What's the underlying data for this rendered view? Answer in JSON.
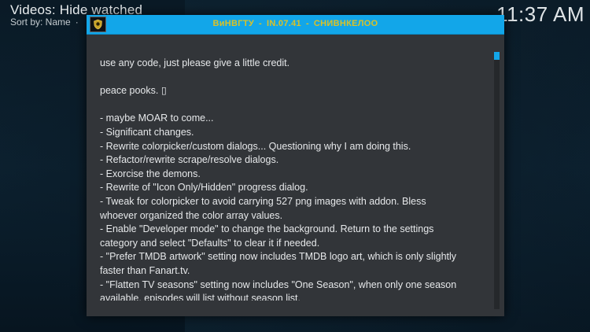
{
  "header": {
    "title": "Videos: Hide watched",
    "sort_label": "Sort by: Name",
    "sort_separator": "·",
    "clock": "11:37 AM"
  },
  "dialog": {
    "icon": "addon-emblem-icon",
    "title_parts": [
      "ВиНВГТУ",
      "​IN.07.41",
      "СНИВНКЕЛОО"
    ],
    "title_separator": "-",
    "accent_color": "#12a6e9",
    "title_color": "#d9c128",
    "scroll_position": 0.0,
    "lines": [
      "use any code, just please give a little credit.",
      "",
      "peace pooks. ▯",
      "",
      "- maybe MOAR to come...",
      "- Significant changes.",
      "- Rewrite colorpicker/custom dialogs...  Questioning why I am doing this.",
      "- Refactor/rewrite scrape/resolve dialogs.",
      "- Exorcise the demons.",
      "- Rewrite of \"Icon Only/Hidden\" progress dialog.",
      "- Tweak for colorpicker to avoid carrying 527 png images with addon.  Bless",
      "whoever organized the color array values.",
      "- Enable \"Developer mode\" to change the background.  Return to the settings",
      "category and select \"Defaults\" to clear it if needed.",
      "- \"Prefer TMDB artwork\" setting now includes TMDB logo art, which is only slightly",
      "faster than Fanart.tv.",
      "- \"Flatten TV seasons\" setting now includes \"One Season\", when only one season",
      "available, episodes will list without season list."
    ]
  }
}
